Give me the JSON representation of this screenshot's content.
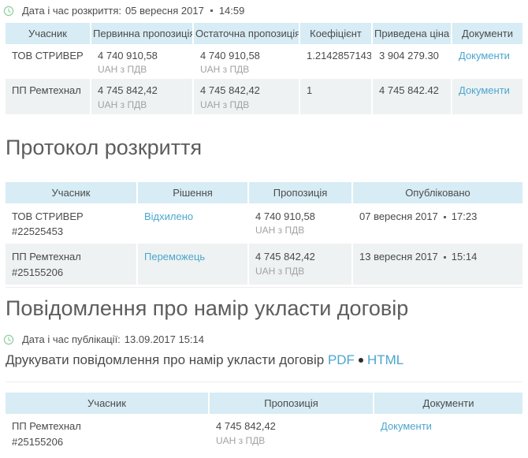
{
  "colors": {
    "table_header_bg": "#d7ecf4",
    "row_alt_bg": "#eef2f2",
    "link": "#4ba6ce",
    "clock_icon_green": "#8fce9f",
    "heading_text": "#5d5d5d",
    "body_text": "#4a4a4a",
    "muted_text": "#a2a2a2"
  },
  "opening": {
    "label": "Дата і час розкриття:",
    "date": "05 вересня 2017",
    "time": "14:59"
  },
  "bids_table": {
    "headers": [
      "Учасник",
      "Первинна пропозиція",
      "Остаточна пропозиція",
      "Коефіцієнт",
      "Приведена ціна",
      "Документи"
    ],
    "rows": [
      {
        "participant": "ТОВ СТРИВЕР",
        "initial_amount": "4 740 910,58",
        "initial_currency": "UAH з ПДВ",
        "final_amount": "4 740 910,58",
        "final_currency": "UAH з ПДВ",
        "coefficient": "1.2142857143",
        "reduced_price": "3 904 279.30",
        "documents_link": "Документи"
      },
      {
        "participant": "ПП Ремтехнал",
        "initial_amount": "4 745 842,42",
        "initial_currency": "UAH з ПДВ",
        "final_amount": "4 745 842,42",
        "final_currency": "UAH з ПДВ",
        "coefficient": "1",
        "reduced_price": "4 745 842.42",
        "documents_link": "Документи"
      }
    ]
  },
  "protocol": {
    "title": "Протокол розкриття",
    "headers": [
      "Учасник",
      "Рішення",
      "Пропозиція",
      "Опубліковано"
    ],
    "rows": [
      {
        "participant": "ТОВ СТРИВЕР",
        "participant_id": "#22525453",
        "decision": "Відхилено",
        "amount": "4 740 910,58",
        "currency": "UAH з ПДВ",
        "published_date": "07 вересня 2017",
        "published_time": "17:23"
      },
      {
        "participant": "ПП Ремтехнал",
        "participant_id": "#25155206",
        "decision": "Переможець",
        "amount": "4 745 842,42",
        "currency": "UAH з ПДВ",
        "published_date": "13 вересня 2017",
        "published_time": "15:14"
      }
    ]
  },
  "intent": {
    "title": "Повідомлення про намір укласти договір",
    "published_label": "Дата і час публікації:",
    "published_value": "13.09.2017 15:14",
    "print_label": "Друкувати повідомлення про намір укласти договір",
    "pdf_link": "PDF",
    "html_link": "HTML",
    "table": {
      "headers": [
        "Учасник",
        "Пропозиція",
        "Документи"
      ],
      "row": {
        "participant": "ПП Ремтехнал",
        "participant_id": "#25155206",
        "amount": "4 745 842,42",
        "currency": "UAH з ПДВ",
        "documents_link": "Документи"
      }
    }
  }
}
